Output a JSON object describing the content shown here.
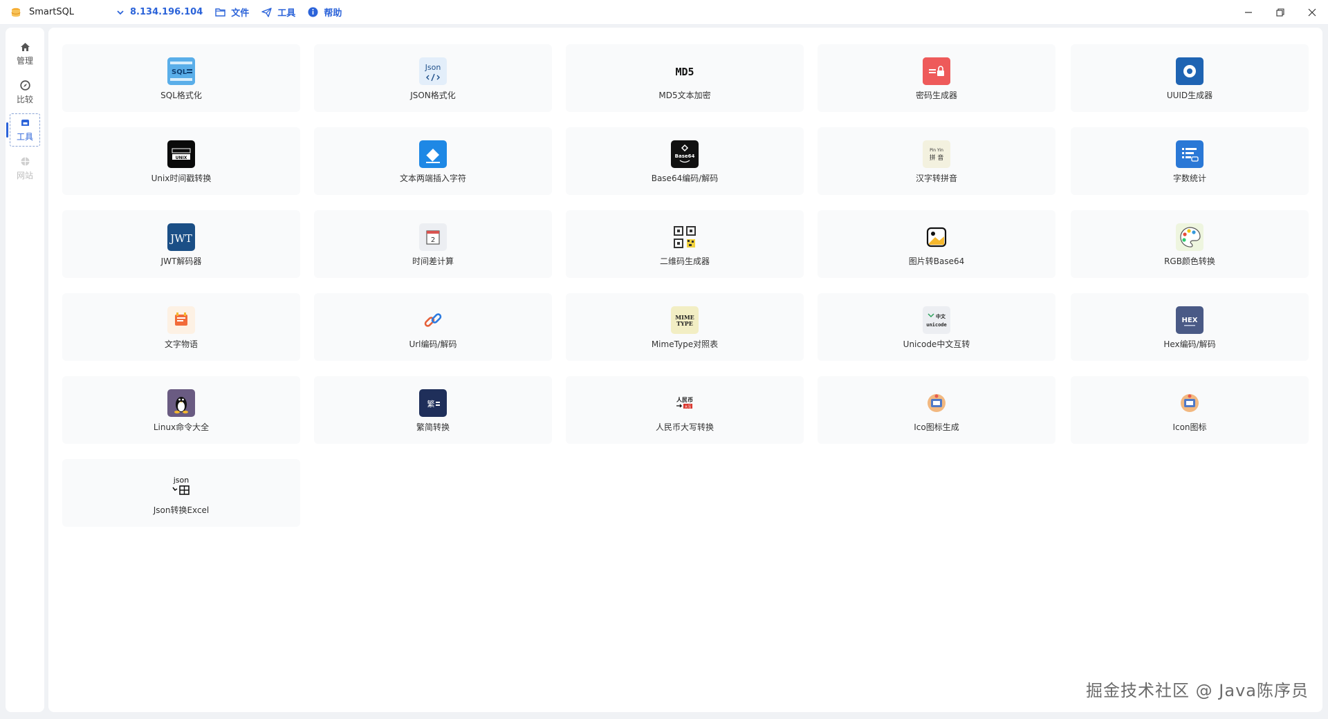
{
  "app": {
    "name": "SmartSQL"
  },
  "titlebar": {
    "items": [
      {
        "label": "8.134.196.104",
        "icon": "chevron-down-icon"
      },
      {
        "label": "文件",
        "icon": "folder-icon"
      },
      {
        "label": "工具",
        "icon": "send-icon"
      },
      {
        "label": "帮助",
        "icon": "info-icon"
      }
    ]
  },
  "sidebar": {
    "items": [
      {
        "label": "管理",
        "icon": "home-icon",
        "state": "normal"
      },
      {
        "label": "比较",
        "icon": "compass-icon",
        "state": "normal"
      },
      {
        "label": "工具",
        "icon": "toolbox-icon",
        "state": "active"
      },
      {
        "label": "网站",
        "icon": "globe-icon",
        "state": "disabled"
      }
    ]
  },
  "tools": [
    {
      "label": "SQL格式化",
      "icon": "sql-format-icon"
    },
    {
      "label": "JSON格式化",
      "icon": "json-format-icon"
    },
    {
      "label": "MD5文本加密",
      "icon": "md5-icon"
    },
    {
      "label": "密码生成器",
      "icon": "password-icon"
    },
    {
      "label": "UUID生成器",
      "icon": "uuid-icon"
    },
    {
      "label": "Unix时间戳转换",
      "icon": "unix-time-icon"
    },
    {
      "label": "文本两端插入字符",
      "icon": "eraser-icon"
    },
    {
      "label": "Base64编码/解码",
      "icon": "base64-icon"
    },
    {
      "label": "汉字转拼音",
      "icon": "pinyin-icon"
    },
    {
      "label": "字数统计",
      "icon": "word-count-icon"
    },
    {
      "label": "JWT解码器",
      "icon": "jwt-icon"
    },
    {
      "label": "时间差计算",
      "icon": "calendar-icon"
    },
    {
      "label": "二维码生成器",
      "icon": "qrcode-icon"
    },
    {
      "label": "图片转Base64",
      "icon": "image-icon"
    },
    {
      "label": "RGB颜色转换",
      "icon": "palette-icon"
    },
    {
      "label": "文字物语",
      "icon": "text-story-icon"
    },
    {
      "label": "Url编码/解码",
      "icon": "link-icon"
    },
    {
      "label": "MimeType对照表",
      "icon": "mime-type-icon"
    },
    {
      "label": "Unicode中文互转",
      "icon": "unicode-icon"
    },
    {
      "label": "Hex编码/解码",
      "icon": "hex-icon"
    },
    {
      "label": "Linux命令大全",
      "icon": "linux-icon"
    },
    {
      "label": "繁简转换",
      "icon": "traditional-simplified-icon"
    },
    {
      "label": "人民币大写转换",
      "icon": "rmb-icon"
    },
    {
      "label": "Ico图标生成",
      "icon": "ico-icon"
    },
    {
      "label": "Icon图标",
      "icon": "icon-icon"
    },
    {
      "label": "Json转换Excel",
      "icon": "json-excel-icon"
    }
  ],
  "icon_text": {
    "sql": "SQL",
    "json": "Json",
    "md5": "MD5",
    "unix": "UNIX",
    "base64": "Base64",
    "pinyin_top": "Pin Yin",
    "pinyin_bottom": "拼 音",
    "jwt": "JWT",
    "calendar_day": "2",
    "mime_top": "MIME",
    "mime_bottom": "TYPE",
    "unicode_top": "中文",
    "unicode_bottom": "unicode",
    "hex": "HEX",
    "traditional": "繁",
    "rmb_top": "人民币",
    "rmb_bottom": "大写",
    "json_excel": "json"
  },
  "watermark": "掘金技术社区 @ Java陈序员",
  "colors": {
    "accent": "#2b63d9",
    "background": "#f0f2f5",
    "card": "#f9fafb"
  }
}
